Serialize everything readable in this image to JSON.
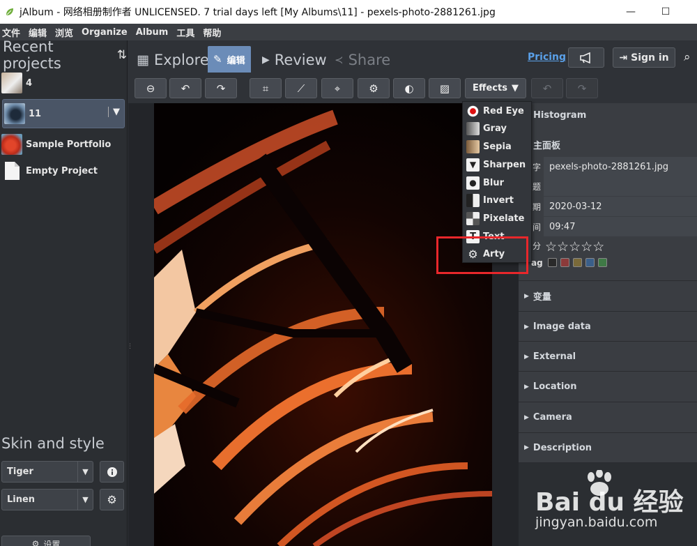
{
  "window": {
    "title": "jAlbum - 网络相册制作者 UNLICENSED. 7 trial days left [My Albums\\11] - pexels-photo-2881261.jpg",
    "minimize": "—",
    "maximize": "☐"
  },
  "menubar": [
    "文件",
    "编辑",
    "浏览",
    "Organize",
    "Album",
    "工具",
    "帮助"
  ],
  "left_panel": {
    "recent_title": "Recent projects",
    "projects": [
      {
        "label": "4"
      },
      {
        "label": "11",
        "selected": true
      },
      {
        "label": "Sample Portfolio"
      },
      {
        "label": "Empty Project"
      }
    ],
    "skin_title": "Skin and style",
    "skin_value": "Tiger",
    "style_value": "Linen",
    "bottom_button": "设置"
  },
  "topnav": {
    "tabs": [
      {
        "label": "Explore"
      },
      {
        "label": "编辑",
        "active": true
      },
      {
        "label": "Review"
      },
      {
        "label": "Share",
        "disabled": true
      }
    ],
    "pricing": "Pricing",
    "sign_in": "Sign in"
  },
  "toolbar": {
    "effects_label": "Effects"
  },
  "effects_menu": {
    "items": [
      {
        "label": "Red Eye",
        "icon": "red-eye-icon"
      },
      {
        "label": "Gray",
        "icon": "gray-icon"
      },
      {
        "label": "Sepia",
        "icon": "sepia-icon"
      },
      {
        "label": "Sharpen",
        "icon": "sharpen-icon"
      },
      {
        "label": "Blur",
        "icon": "blur-icon"
      },
      {
        "label": "Invert",
        "icon": "invert-icon"
      },
      {
        "label": "Pixelate",
        "icon": "pixelate-icon"
      },
      {
        "label": "Text",
        "icon": "text-icon"
      },
      {
        "label": "Arty",
        "icon": "gear-icon"
      }
    ],
    "highlight_color": "#e8272b"
  },
  "right_panel": {
    "histogram": "Histogram",
    "main_panel": "主面板",
    "fields": [
      {
        "label": "字",
        "value": "pexels-photo-2881261.jpg"
      },
      {
        "label": "题",
        "value": ""
      },
      {
        "label": "期",
        "value": "2020-03-12"
      },
      {
        "label": "间",
        "value": "09:47"
      }
    ],
    "rating_label": "分",
    "rating": 0,
    "rating_max": 5,
    "flag_label": "ag",
    "flag_colors": [
      "#2a2a2a",
      "#8b3a3a",
      "#7a6a3a",
      "#3a5f8a",
      "#3f7a46"
    ],
    "sections": [
      "变量",
      "Image data",
      "External",
      "Location",
      "Camera",
      "Description"
    ]
  },
  "watermark": {
    "brand": "Bai du 经验",
    "url": "jingyan.baidu.com"
  }
}
